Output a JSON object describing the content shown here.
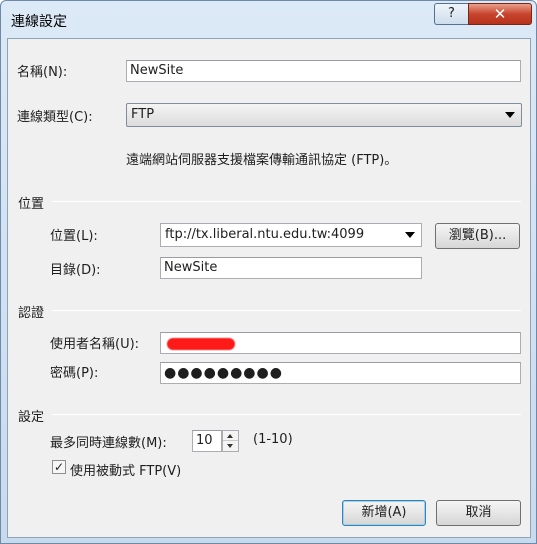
{
  "window": {
    "title": "連線設定",
    "help_label": "?",
    "close_label": "✕"
  },
  "name": {
    "label": "名稱(N):",
    "value": "NewSite"
  },
  "connection_type": {
    "label": "連線類型(C):",
    "value": "FTP",
    "description": "遠端網站伺服器支援檔案傳輸通訊協定 (FTP)。"
  },
  "location_group": {
    "header": "位置",
    "location_label": "位置(L):",
    "location_value": "ftp://tx.liberal.ntu.edu.tw:4099",
    "browse_label": "瀏覽(B)...",
    "directory_label": "目錄(D):",
    "directory_value": "NewSite"
  },
  "auth_group": {
    "header": "認證",
    "username_label": "使用者名稱(U):",
    "password_label": "密碼(P):",
    "password_value": "●●●●●●●●●"
  },
  "settings_group": {
    "header": "設定",
    "max_connections_label": "最多同時連線數(M):",
    "max_connections_value": "10",
    "range_hint": "(1-10)",
    "passive_ftp_label": "使用被動式 FTP(V)",
    "passive_ftp_checked": true
  },
  "buttons": {
    "add_label": "新增(A)",
    "cancel_label": "取消"
  }
}
